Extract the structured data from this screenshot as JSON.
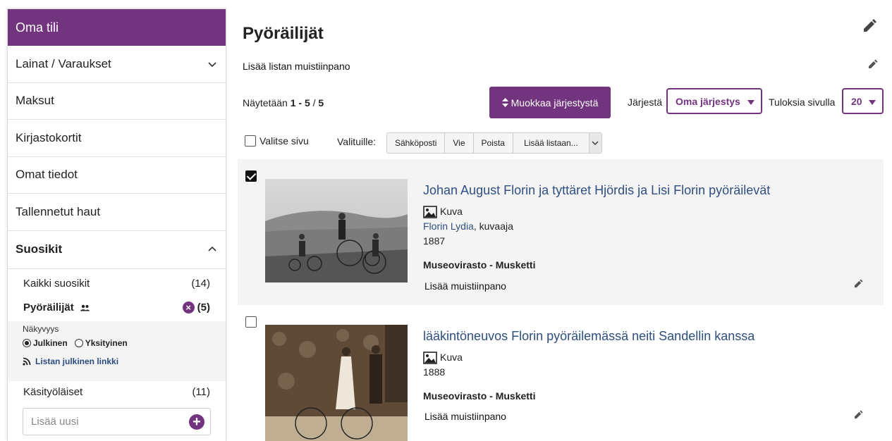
{
  "sidebar": {
    "header": "Oma tili",
    "items": [
      {
        "label": "Lainat / Varaukset"
      },
      {
        "label": "Maksut"
      },
      {
        "label": "Kirjastokortit"
      },
      {
        "label": "Omat tiedot"
      },
      {
        "label": "Tallennetut haut"
      },
      {
        "label": "Suosikit"
      }
    ],
    "favorites": [
      {
        "label": "Kaikki suosikit",
        "count": "(14)"
      },
      {
        "label": "Pyöräilijät",
        "count": "(5)",
        "active": true
      },
      {
        "label": "Käsityöläiset",
        "count": "(11)"
      }
    ],
    "visibility_label": "Näkyvyys",
    "visibility_public": "Julkinen",
    "visibility_private": "Yksityinen",
    "public_link": "Listan julkinen linkki",
    "add_new_placeholder": "Lisää uusi"
  },
  "main": {
    "title": "Pyöräilijät",
    "add_list_note": "Lisää listan muistiinpano",
    "showing_prefix": "Näytetään",
    "showing_range": "1 - 5",
    "showing_sep": "/",
    "showing_total": "5",
    "edit_order_button": "Muokkaa järjestystä",
    "sort_label": "Järjestä",
    "sort_value": "Oma järjestys",
    "per_page_label": "Tuloksia sivulla",
    "per_page_value": "20",
    "select_page": "Valitse sivu",
    "selected_label": "Valituille:",
    "bulk_actions": {
      "email": "Sähköposti",
      "export": "Vie",
      "delete": "Poista",
      "add_to_list": "Lisää listaan..."
    }
  },
  "records": [
    {
      "title": "Johan August Florin ja tyttäret Hjördis ja Lisi Florin pyöräilevät",
      "format": "Kuva",
      "author": "Florin Lydia",
      "author_role": ", kuvaaja",
      "year": "1887",
      "source": "Museovirasto - Musketti",
      "add_note": "Lisää muistiinpano",
      "checked": true
    },
    {
      "title": "lääkintöneuvos Florin pyöräilemässä neiti Sandellin kanssa",
      "format": "Kuva",
      "year": "1888",
      "source": "Museovirasto - Musketti",
      "add_note": "Lisää muistiinpano",
      "checked": false
    }
  ],
  "colors": {
    "accent": "#73347f",
    "link": "#2e4f7f"
  }
}
